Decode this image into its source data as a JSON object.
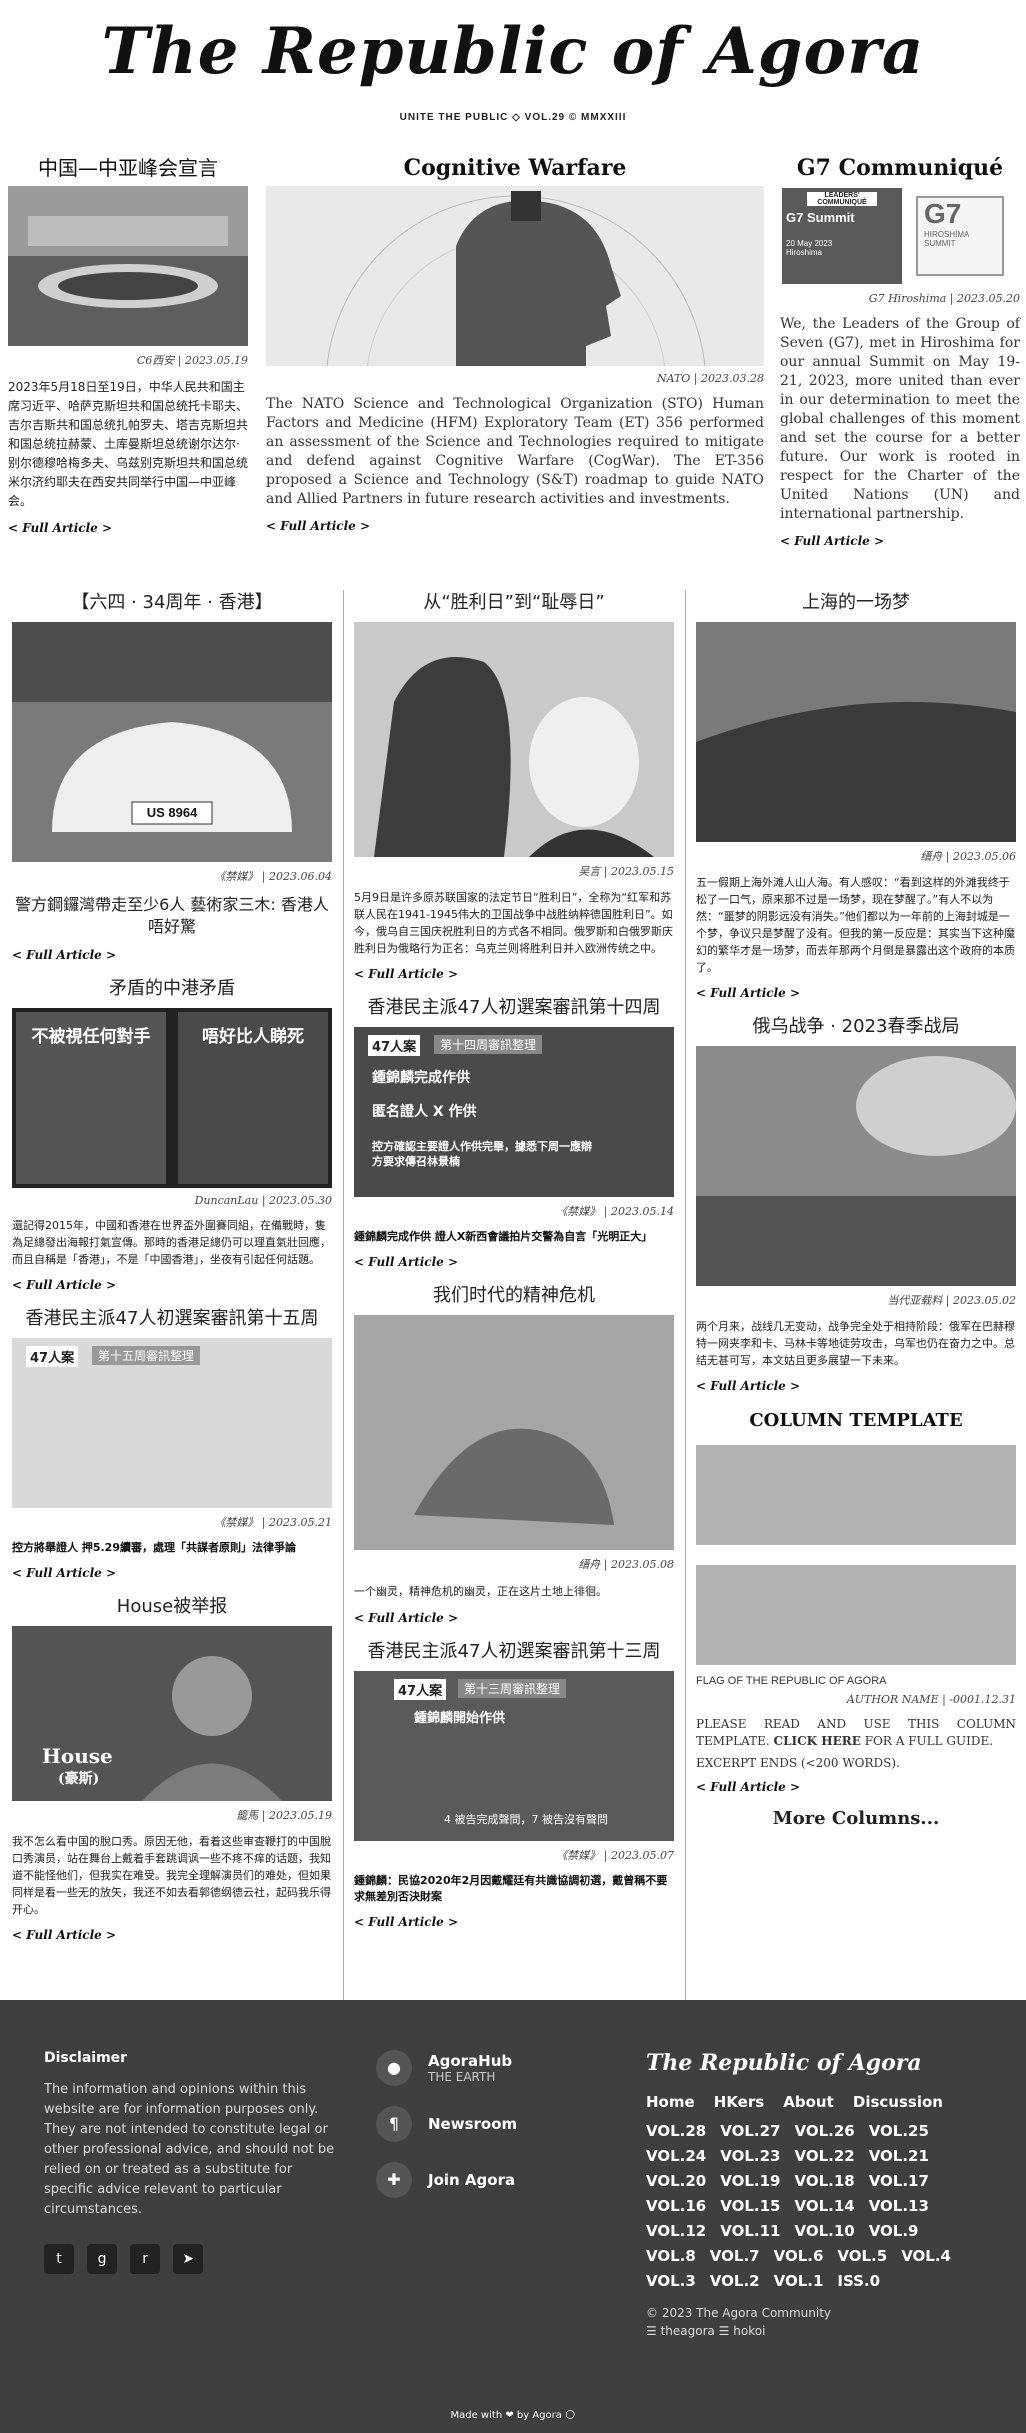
{
  "masthead": {
    "title": "The Republic of Agora",
    "tagline": "UNITE THE PUBLIC ◇ VOL.29 © MMXXIII"
  },
  "top": [
    {
      "heading": "中国—中亚峰会宣言",
      "byline": "C6西安 | 2023.05.19",
      "body": "2023年5月18日至19日，中华人民共和国主席习近平、哈萨克斯坦共和国总统托卡耶夫、吉尔吉斯共和国总统扎帕罗夫、塔吉克斯坦共和国总统拉赫蒙、土库曼斯坦总统谢尔达尔·别尔德穆哈梅多夫、乌兹别克斯坦共和国总统米尔济约耶夫在西安共同举行中国—中亚峰会。",
      "link": "< Full Article >"
    },
    {
      "heading": "Cognitive Warfare",
      "byline": "NATO | 2023.03.28",
      "body": "The NATO Science and Technological Organization (STO) Human Factors and Medicine (HFM) Exploratory Team (ET) 356 performed an assessment of the Science and Technologies required to mitigate and defend against Cognitive Warfare (CogWar). The ET-356 proposed a Science and Technology (S&T) roadmap to guide NATO and Allied Partners in future research activities and investments.",
      "link": "< Full Article >"
    },
    {
      "heading": "G7 Communiqué",
      "byline": "G7 Hiroshima | 2023.05.20",
      "body": "We, the Leaders of the Group of Seven (G7), met in Hiroshima for our annual Summit on May 19-21, 2023, more united than ever in our determination to meet the global challenges of this moment and set the course for a better future. Our work is rooted in respect for the Charter of the United Nations (UN) and international partnership.",
      "link": "< Full Article >",
      "g7_card": {
        "l1": "LEADERS' COMMUNIQUÉ",
        "l2": "G7 Summit",
        "l3": "20 May 2023",
        "l4": "Hiroshima",
        "logo": "G7",
        "logo2": "HIROSHIMA SUMMIT"
      }
    }
  ],
  "grid": {
    "c1": [
      {
        "heading": "【六四 · 34周年 · 香港】",
        "byline": "《禁媒》 | 2023.06.04",
        "sub": "警方鋼鑼灣帶走至少6人 藝術家三木: 香港人唔好驚",
        "link": "< Full Article >",
        "plate": "US 8964"
      },
      {
        "heading": "矛盾的中港矛盾",
        "byline": "DuncanLau | 2023.05.30",
        "body": "還記得2015年，中國和香港在世界盃外圍賽同組，在備戰時，隻為足總發出海報打氣宣傳。那時的香港足總仍可以理直氣壯回應，而且自稱是「香港」，不是「中國香港」，坐夜有引起任何話題。",
        "link": "< Full Article >",
        "poster_l": "不被視任何對手",
        "poster_r": "唔好比人睇死"
      },
      {
        "heading": "香港民主派47人初選案審訊第十五周",
        "byline": "《禁媒》 | 2023.05.21",
        "bold": "控方將舉證人 押5.29續審，處理「共謀者原則」法律爭論",
        "link": "< Full Article >",
        "card_tag": "47人案",
        "card_title": "第十五周審訊整理"
      },
      {
        "heading": "House被举报",
        "byline": "籠馬 | 2023.05.19",
        "body": "我不怎么看中国的脫口秀。原因无他，看着这些审查鞭打的中国脫口秀演员，站在舞台上戴着手套跳调讽一些不疼不痒的话题，我知道不能怪他们，但我实在难受。我完全理解演员们的难处，但如果同样是看一些无的放矢，我还不如去看郭德纲德云社，起码我乐得开心。",
        "link": "< Full Article >",
        "overlay": "House",
        "overlay2": "(豪斯)"
      }
    ],
    "c2": [
      {
        "heading": "从“胜利日”到“耻辱日”",
        "byline": "吴言 | 2023.05.15",
        "body": "5月9日是许多原苏联国家的法定节日“胜利日”，全称为“红军和苏联人民在1941-1945伟大的卫国战争中战胜纳粹德国胜利日”。如今，俄乌自三国庆祝胜利日的方式各不相同。俄罗斯和白俄罗斯庆胜利日为俄略行为正名：乌克兰则将胜利日并入欧洲传统之中。",
        "link": "< Full Article >"
      },
      {
        "heading": "香港民主派47人初選案審訊第十四周",
        "byline": "《禁媒》 | 2023.05.14",
        "bold": "鍾錦麟完成作供 證人X新西會議拍片交警為自言「光明正大」",
        "link": "< Full Article >",
        "card_tag": "47人案",
        "card_title": "第十四周審訊整理",
        "items": [
          "鍾錦麟完成作供",
          "匿名證人 X 作供",
          "控方確認主要證人作供完畢，據悉下周一應辯方要求傳召林景楠"
        ]
      },
      {
        "heading": "我们时代的精神危机",
        "byline": "缙舟 | 2023.05.08",
        "body": "一个幽灵，精神危机的幽灵，正在这片土地上徘徊。",
        "link": "< Full Article >"
      },
      {
        "heading": "香港民主派47人初選案審訊第十三周",
        "byline": "《禁媒》 | 2023.05.07",
        "bold": "鍾錦麟：民協2020年2月因戴耀廷有共識協調初選，戴曾稱不要求無差別否決財案",
        "link": "< Full Article >",
        "card_tag": "47人案",
        "card_title": "第十三周審訊整理",
        "card_item": "鍾錦麟開始作供",
        "card_bottom": "4 被告完成聲問，7 被告沒有聲問"
      }
    ],
    "c3": [
      {
        "heading": "上海的一场梦",
        "byline": "缙舟 | 2023.05.06",
        "body": "五一假期上海外滩人山人海。有人感叹：“看到这样的外滩我终于松了一口气，原来那不过是一场梦，现在梦醒了。”有人不以为然：“噩梦的阴影远没有消失。”他们都以为一年前的上海封城是一个梦，争议只是梦醒了没有。但我的第一反应是：其实当下这种魔幻的繁华才是一场梦，而去年那两个月倒是暴露出这个政府的本质了。",
        "link": "< Full Article >"
      },
      {
        "heading": "俄乌战争 · 2023春季战局",
        "byline": "当代亚载料 | 2023.05.02",
        "body": "两个月来，战线几无变动，战争完全处于相持阶段：俄军在巴赫穆特一网夹李和卡、马林卡等地徒劳攻击，乌军也仍在奋力之中。总结无甚可写，本文姑且更多展望一下未来。",
        "link": "< Full Article >"
      },
      {
        "heading": "COLUMN TEMPLATE",
        "caption": "FLAG OF THE REPUBLIC OF AGORA",
        "byline": "AUTHOR NAME | -0001.12.31",
        "body_pre": "PLEASE READ AND USE THIS COLUMN TEMPLATE.",
        "body_link": "CLICK HERE",
        "body_post": "FOR A FULL GUIDE.",
        "excerpt": "EXCERPT ENDS (<200 WORDS).",
        "link": "< Full Article >",
        "more": "More Columns..."
      }
    ]
  },
  "footer": {
    "disclaimer_title": "Disclaimer",
    "disclaimer": "The information and opinions within this website are for information purposes only. They are not intended to constitute legal or other professional advice, and should not be relied on or treated as a substitute for specific advice relevant to particular circumstances.",
    "links": [
      {
        "title": "AgoraHub",
        "sub": "THE EARTH",
        "icon": "map-pin-icon"
      },
      {
        "title": "Newsroom",
        "sub": "",
        "icon": "paragraph-icon"
      },
      {
        "title": "Join Agora",
        "sub": "",
        "icon": "puzzle-icon"
      }
    ],
    "brand": "The Republic of Agora",
    "nav": [
      "Home",
      "HKers",
      "About",
      "Discussion"
    ],
    "vols": [
      "VOL.28",
      "VOL.27",
      "VOL.26",
      "VOL.25",
      "VOL.24",
      "VOL.23",
      "VOL.22",
      "VOL.21",
      "VOL.20",
      "VOL.19",
      "VOL.18",
      "VOL.17",
      "VOL.16",
      "VOL.15",
      "VOL.14",
      "VOL.13",
      "VOL.12",
      "VOL.11",
      "VOL.10",
      "VOL.9",
      "VOL.8",
      "VOL.7",
      "VOL.6",
      "VOL.5",
      "VOL.4",
      "VOL.3",
      "VOL.2",
      "VOL.1",
      "ISS.0"
    ],
    "copyright": "© 2023 The Agora Community",
    "credits": "☰ theagora ☰ hokoi",
    "made": "Made with ❤ by Agora 🌕",
    "socials": [
      "twitter-icon",
      "github-icon",
      "reddit-icon",
      "telegram-icon"
    ]
  }
}
